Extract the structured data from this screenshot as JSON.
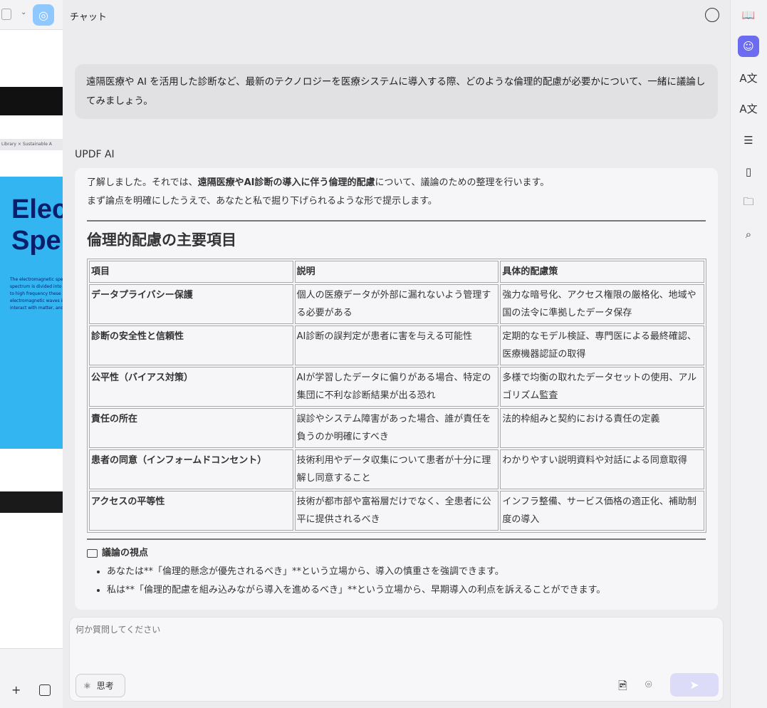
{
  "background_app": {
    "tabs": "Library  ×  Sustainable A",
    "poster_title": "Elec\nSpe",
    "poster_text": "The electromagnetic spec\nspectrum is divided into s\nto high frequency these a\nelectromagnetic waves in\ninteract with matter, and t"
  },
  "header": {
    "title": "チャット"
  },
  "user_message": "遠隔医療や AI を活用した診断など、最新のテクノロジーを医療システムに導入する際、どのような倫理的配慮が必要かについて、一緒に議論してみましょう。",
  "ai": {
    "label": "UPDF AI",
    "intro_pre": "了解しました。それでは、",
    "intro_bold": "遠隔医療やAI診断の導入に伴う倫理的配慮",
    "intro_post": "について、議論のための整理を行います。",
    "intro2": "まず論点を明確にしたうえで、あなたと私で掘り下げられるような形で提示します。",
    "heading": "倫理的配慮の主要項目",
    "table": {
      "headers": [
        "項目",
        "説明",
        "具体的配慮策"
      ],
      "rows": [
        [
          "データプライバシー保護",
          "個人の医療データが外部に漏れないよう管理する必要がある",
          "強力な暗号化、アクセス権限の厳格化、地域や国の法令に準拠したデータ保存"
        ],
        [
          "診断の安全性と信頼性",
          "AI診断の誤判定が患者に害を与える可能性",
          "定期的なモデル検証、専門医による最終確認、医療機器認証の取得"
        ],
        [
          "公平性（バイアス対策）",
          "AIが学習したデータに偏りがある場合、特定の集団に不利な診断結果が出る恐れ",
          "多様で均衡の取れたデータセットの使用、アルゴリズム監査"
        ],
        [
          "責任の所在",
          "誤診やシステム障害があった場合、誰が責任を負うのか明確にすべき",
          "法的枠組みと契約における責任の定義"
        ],
        [
          "患者の同意（インフォームドコンセント）",
          "技術利用やデータ収集について患者が十分に理解し同意すること",
          "わかりやすい説明資料や対話による同意取得"
        ],
        [
          "アクセスの平等性",
          "技術が都市部や富裕層だけでなく、全患者に公平に提供されるべき",
          "インフラ整備、サービス価格の適正化、補助制度の導入"
        ]
      ]
    },
    "discussion_title": "議論の視点",
    "bullets": [
      "あなたは**「倫理的懸念が優先されるべき」**という立場から、導入の慎重さを強調できます。",
      "私は**「倫理的配慮を組み込みながら導入を進めるべき」**という立場から、早期導入の利点を訴えることができます。"
    ]
  },
  "input": {
    "placeholder": "何か質問してください",
    "think_label": "思考"
  },
  "colors": {
    "accent": "#6c6cf0",
    "send_disabled": "#dcdcf8"
  }
}
